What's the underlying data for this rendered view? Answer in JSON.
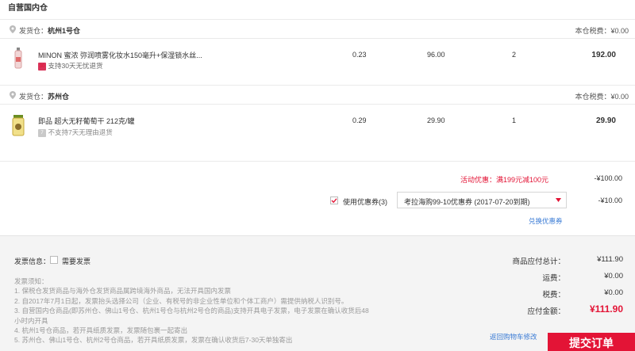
{
  "header": {
    "title": "自营国内仓"
  },
  "warehouses": [
    {
      "label": "发货仓：",
      "name": "杭州1号仓",
      "tax": "本仓税费：¥0.00",
      "product": {
        "name": "MINON 蜜浓 弥润喷雾化妆水150毫升+保湿锁水丝...",
        "note": "支持30天无忧退货",
        "badge": "30",
        "tax_rate": "0.23",
        "price": "96.00",
        "qty": "2",
        "subtotal": "192.00"
      }
    },
    {
      "label": "发货仓：",
      "name": "苏州仓",
      "tax": "本仓税费：¥0.00",
      "product": {
        "name": "即品 超大无籽葡萄干 212克/罐",
        "note": "不支持7天无理由退货",
        "badge": "7",
        "tax_rate": "0.29",
        "price": "29.90",
        "qty": "1",
        "subtotal": "29.90"
      }
    }
  ],
  "promotion": {
    "label": "活动优惠：满199元减100元",
    "amount": "-¥100.00"
  },
  "coupon": {
    "label": "使用优惠券(3)",
    "selected": "考拉海购99-10优惠券 (2017-07-20到期)",
    "amount": "-¥10.00",
    "switch_link": "兑换优惠券"
  },
  "invoice": {
    "label": "发票信息：",
    "need_label": "需要发票",
    "notes_title": "发票须知：",
    "notes": [
      "1. 保税仓发货商品与海外仓发货商品属跨境海外商品，无法开具国内发票",
      "2. 自2017年7月1日起，发票抬头选择公司（企业、有税号的非企业性单位和个体工商户）需提供纳税人识别号。",
      "3. 自营国内仓商品(即苏州仓、佛山1号仓、杭州1号仓与杭州2号仓的商品)支持开具电子发票，电子发票在确认收货后48",
      "小时内开具",
      "4. 杭州1号仓商品，若开具纸质发票，发票随包裹一起寄出",
      "5. 苏州仓、佛山1号仓、杭州2号仓商品，若开具纸质发票，发票在确认收货后7-30天单独寄出"
    ]
  },
  "summary": {
    "goods_label": "商品应付总计：",
    "goods_value": "¥111.90",
    "shipping_label": "运费：",
    "shipping_value": "¥0.00",
    "tax_label": "税费：",
    "tax_value": "¥0.00",
    "payable_label": "应付金额：",
    "payable_value": "¥111.90"
  },
  "actions": {
    "back_link": "返回购物车修改",
    "submit": "提交订单"
  }
}
